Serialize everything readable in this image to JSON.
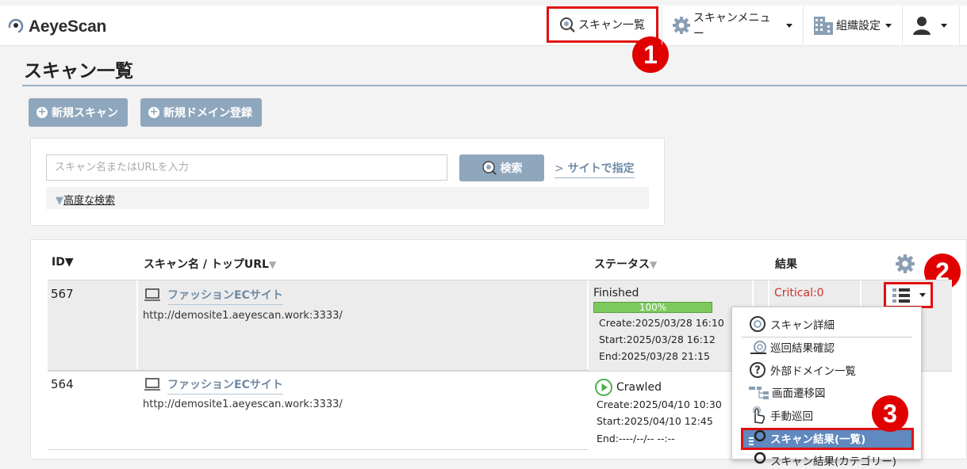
{
  "app": {
    "logo_text": "AeyeScan"
  },
  "topnav": {
    "scan_list": "スキャン一覧",
    "scan_menu": "スキャンメニュー",
    "org_settings": "組織設定"
  },
  "page": {
    "title": "スキャン一覧"
  },
  "actions": {
    "new_scan": "新規スキャン",
    "new_domain": "新規ドメイン登録"
  },
  "search": {
    "placeholder": "スキャン名またはURLを入力",
    "button": "検索",
    "site_link": "サイトで指定",
    "advanced": "高度な検索"
  },
  "table": {
    "headers": {
      "id": "ID",
      "name": "スキャン名 / トップURL",
      "status": "ステータス",
      "result": "結果"
    },
    "rows": [
      {
        "id": "567",
        "name": "ファッションECサイト",
        "url": "http://demosite1.aeyescan.work:3333/",
        "status": "Finished",
        "progress_label": "100%",
        "progress": 1.0,
        "create": "Create:2025/03/28 16:10",
        "start": "Start:2025/03/28 16:12",
        "end": "End:2025/03/28 21:15",
        "result": "Critical:0"
      },
      {
        "id": "564",
        "name": "ファッションECサイト",
        "url": "http://demosite1.aeyescan.work:3333/",
        "status": "Crawled",
        "create": "Create:2025/04/10 10:30",
        "start": "Start:2025/04/10 12:45",
        "end": "End:----/--/-- --:--"
      }
    ]
  },
  "row_menu": {
    "items": [
      "スキャン詳細",
      "巡回結果確認",
      "外部ドメイン一覧",
      "画面遷移図",
      "手動巡回",
      "スキャン結果(一覧)",
      "スキャン結果(カテゴリー)"
    ]
  },
  "annotations": [
    "1",
    "2",
    "3"
  ],
  "colors": {
    "accent": "#8fa7bd",
    "link": "#6f8aa5",
    "highlight": "#e01010",
    "progress": "#7dc95e",
    "selected": "#5f89bf"
  }
}
